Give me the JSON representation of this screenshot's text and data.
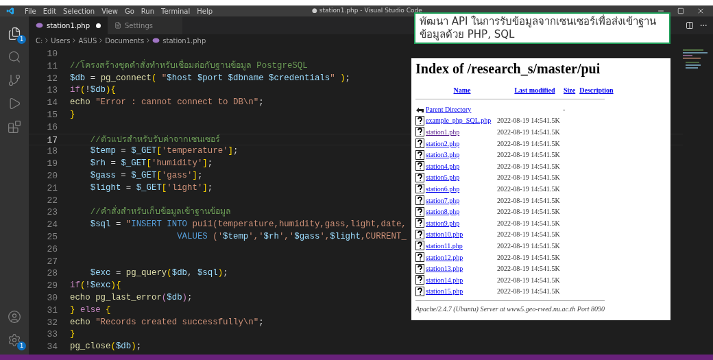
{
  "menu": [
    "File",
    "Edit",
    "Selection",
    "View",
    "Go",
    "Run",
    "Terminal",
    "Help"
  ],
  "window": {
    "title": "● station1.php - Visual Studio Code"
  },
  "activity_bar": {
    "explorer_badge": "1",
    "settings_badge": "1"
  },
  "tabs": [
    {
      "label": "station1.php",
      "selected": true,
      "modified": true,
      "kind": "php"
    },
    {
      "label": "Settings",
      "selected": false,
      "modified": false,
      "kind": "settings"
    }
  ],
  "breadcrumb": [
    "C:",
    "Users",
    "ASUS",
    "Documents",
    "station1.php"
  ],
  "code_lines": [
    {
      "number": "10",
      "active": false
    },
    {
      "number": "11",
      "active": false,
      "tokens": [
        {
          "kind": "comment",
          "t": "//โครงสร้างชุดคำสั่งทำหรับเชื่อมต่อกับฐานข้อมูล PostgreSQL"
        }
      ]
    },
    {
      "number": "12",
      "active": false,
      "tokens": [
        {
          "kind": "var",
          "t": "$db"
        },
        {
          "kind": "punct",
          "t": " = "
        },
        {
          "kind": "fn",
          "t": "pg_connect"
        },
        {
          "kind": "brace",
          "t": "("
        },
        {
          "kind": "str",
          "t": " \""
        },
        {
          "kind": "var",
          "t": "$host $port $dbname $credentials"
        },
        {
          "kind": "str",
          "t": "\" "
        },
        {
          "kind": "brace",
          "t": ")"
        },
        {
          "kind": "punct",
          "t": ";"
        }
      ]
    },
    {
      "number": "13",
      "active": false,
      "tokens": [
        {
          "kind": "kw",
          "t": "if"
        },
        {
          "kind": "brace",
          "t": "("
        },
        {
          "kind": "punct",
          "t": "!"
        },
        {
          "kind": "var",
          "t": "$db"
        },
        {
          "kind": "brace",
          "t": "){"
        }
      ]
    },
    {
      "number": "14",
      "active": false,
      "tokens": [
        {
          "kind": "fn",
          "t": "echo "
        },
        {
          "kind": "str",
          "t": "\"Error : cannot connect to DB\\n\""
        },
        {
          "kind": "punct",
          "t": ";"
        }
      ]
    },
    {
      "number": "15",
      "active": false,
      "tokens": [
        {
          "kind": "brace",
          "t": "}"
        }
      ]
    },
    {
      "number": "16",
      "active": false
    },
    {
      "number": "17",
      "active": true,
      "tokens": [
        {
          "kind": "comment",
          "t": "    //ตัวแปรสำหรับรับค่าจากเซนเซอร์"
        }
      ]
    },
    {
      "number": "18",
      "active": false,
      "tokens": [
        {
          "kind": "var",
          "t": "    $temp"
        },
        {
          "kind": "punct",
          "t": " = "
        },
        {
          "kind": "var",
          "t": "$_GET"
        },
        {
          "kind": "brace",
          "t": "["
        },
        {
          "kind": "str",
          "t": "'temperature'"
        },
        {
          "kind": "brace",
          "t": "]"
        },
        {
          "kind": "punct",
          "t": ";"
        }
      ]
    },
    {
      "number": "19",
      "active": false,
      "tokens": [
        {
          "kind": "var",
          "t": "    $rh"
        },
        {
          "kind": "punct",
          "t": " = "
        },
        {
          "kind": "var",
          "t": "$_GET"
        },
        {
          "kind": "brace",
          "t": "["
        },
        {
          "kind": "str",
          "t": "'humidity'"
        },
        {
          "kind": "brace",
          "t": "]"
        },
        {
          "kind": "punct",
          "t": ";"
        }
      ]
    },
    {
      "number": "20",
      "active": false,
      "tokens": [
        {
          "kind": "var",
          "t": "    $gass"
        },
        {
          "kind": "punct",
          "t": " = "
        },
        {
          "kind": "var",
          "t": "$_GET"
        },
        {
          "kind": "brace",
          "t": "["
        },
        {
          "kind": "str",
          "t": "'gass'"
        },
        {
          "kind": "brace",
          "t": "]"
        },
        {
          "kind": "punct",
          "t": ";"
        }
      ]
    },
    {
      "number": "21",
      "active": false,
      "tokens": [
        {
          "kind": "var",
          "t": "    $light"
        },
        {
          "kind": "punct",
          "t": " = "
        },
        {
          "kind": "var",
          "t": "$_GET"
        },
        {
          "kind": "brace",
          "t": "["
        },
        {
          "kind": "str",
          "t": "'light'"
        },
        {
          "kind": "brace",
          "t": "]"
        },
        {
          "kind": "punct",
          "t": ";"
        }
      ]
    },
    {
      "number": "22",
      "active": false
    },
    {
      "number": "23",
      "active": false,
      "tokens": [
        {
          "kind": "comment",
          "t": "    //คำสั่งสำหรับเก็บข้อมูลเข้าฐานข้อมูล"
        }
      ]
    },
    {
      "number": "24",
      "active": false,
      "tokens": [
        {
          "kind": "var",
          "t": "    $sql"
        },
        {
          "kind": "punct",
          "t": " = "
        },
        {
          "kind": "str",
          "t": "\""
        },
        {
          "kind": "sql",
          "t": "INSERT INTO "
        },
        {
          "kind": "str",
          "t": "pui1(temperature,humidity,gass,light,date,"
        }
      ]
    },
    {
      "number": "25",
      "active": false,
      "tokens": [
        {
          "kind": "sql",
          "t": "                     VALUES "
        },
        {
          "kind": "str",
          "t": "('"
        },
        {
          "kind": "var",
          "t": "$temp"
        },
        {
          "kind": "str",
          "t": "','"
        },
        {
          "kind": "var",
          "t": "$rh"
        },
        {
          "kind": "str",
          "t": "','"
        },
        {
          "kind": "var",
          "t": "$gass"
        },
        {
          "kind": "str",
          "t": "',"
        },
        {
          "kind": "var",
          "t": "$light"
        },
        {
          "kind": "str",
          "t": ",CURRENT_"
        }
      ]
    },
    {
      "number": "26",
      "active": false
    },
    {
      "number": "27",
      "active": false
    },
    {
      "number": "28",
      "active": false,
      "tokens": [
        {
          "kind": "var",
          "t": "    $exc"
        },
        {
          "kind": "punct",
          "t": " = "
        },
        {
          "kind": "fn",
          "t": "pg_query"
        },
        {
          "kind": "brace",
          "t": "("
        },
        {
          "kind": "var",
          "t": "$db"
        },
        {
          "kind": "punct",
          "t": ", "
        },
        {
          "kind": "var",
          "t": "$sql"
        },
        {
          "kind": "brace",
          "t": ")"
        },
        {
          "kind": "punct",
          "t": ";"
        }
      ]
    },
    {
      "number": "29",
      "active": false,
      "tokens": [
        {
          "kind": "kw",
          "t": "if"
        },
        {
          "kind": "brace",
          "t": "("
        },
        {
          "kind": "punct",
          "t": "!"
        },
        {
          "kind": "var",
          "t": "$exc"
        },
        {
          "kind": "brace",
          "t": "){"
        }
      ]
    },
    {
      "number": "30",
      "active": false,
      "tokens": [
        {
          "kind": "fn",
          "t": "echo pg_last_error"
        },
        {
          "kind": "kw",
          "t": "("
        },
        {
          "kind": "var",
          "t": "$db"
        },
        {
          "kind": "kw",
          "t": ")"
        },
        {
          "kind": "punct",
          "t": ";"
        }
      ]
    },
    {
      "number": "31",
      "active": false,
      "tokens": [
        {
          "kind": "brace",
          "t": "} "
        },
        {
          "kind": "kw",
          "t": "else "
        },
        {
          "kind": "brace",
          "t": "{"
        }
      ]
    },
    {
      "number": "32",
      "active": false,
      "tokens": [
        {
          "kind": "fn",
          "t": "echo "
        },
        {
          "kind": "str",
          "t": "\"Records created successfully\\n\""
        },
        {
          "kind": "punct",
          "t": ";"
        }
      ]
    },
    {
      "number": "33",
      "active": false,
      "tokens": [
        {
          "kind": "brace",
          "t": "}"
        }
      ]
    },
    {
      "number": "34",
      "active": false,
      "tokens": [
        {
          "kind": "fn",
          "t": "pg_close"
        },
        {
          "kind": "brace",
          "t": "("
        },
        {
          "kind": "var",
          "t": "$db"
        },
        {
          "kind": "brace",
          "t": ")"
        },
        {
          "kind": "punct",
          "t": ";"
        }
      ]
    }
  ],
  "caption": "พัฒนา API ในการรับข้อมูลจากเซนเซอร์เพื่อส่งเข้าฐานข้อมูลด้วย PHP, SQL",
  "index_page": {
    "title": "Index of /research_s/master/pui",
    "columns": [
      "Name",
      "Last modified",
      "Size",
      "Description"
    ],
    "rows": [
      {
        "kind": "parent",
        "name": "Parent Directory",
        "modified": "",
        "size": "-",
        "visited": false
      },
      {
        "kind": "file",
        "name": "example_php_SQL.php",
        "modified": "2022-08-19 14:54",
        "size": "1.5K",
        "visited": false
      },
      {
        "kind": "file",
        "name": "station1.php",
        "modified": "2022-08-19 14:54",
        "size": "1.5K",
        "visited": true
      },
      {
        "kind": "file",
        "name": "station2.php",
        "modified": "2022-08-19 14:54",
        "size": "1.5K",
        "visited": false
      },
      {
        "kind": "file",
        "name": "station3.php",
        "modified": "2022-08-19 14:54",
        "size": "1.5K",
        "visited": false
      },
      {
        "kind": "file",
        "name": "station4.php",
        "modified": "2022-08-19 14:54",
        "size": "1.5K",
        "visited": false
      },
      {
        "kind": "file",
        "name": "station5.php",
        "modified": "2022-08-19 14:54",
        "size": "1.5K",
        "visited": false
      },
      {
        "kind": "file",
        "name": "station6.php",
        "modified": "2022-08-19 14:54",
        "size": "1.5K",
        "visited": false
      },
      {
        "kind": "file",
        "name": "station7.php",
        "modified": "2022-08-19 14:54",
        "size": "1.5K",
        "visited": false
      },
      {
        "kind": "file",
        "name": "station8.php",
        "modified": "2022-08-19 14:54",
        "size": "1.5K",
        "visited": false
      },
      {
        "kind": "file",
        "name": "station9.php",
        "modified": "2022-08-19 14:54",
        "size": "1.5K",
        "visited": false
      },
      {
        "kind": "file",
        "name": "station10.php",
        "modified": "2022-08-19 14:54",
        "size": "1.5K",
        "visited": false
      },
      {
        "kind": "file",
        "name": "station11.php",
        "modified": "2022-08-19 14:54",
        "size": "1.5K",
        "visited": false
      },
      {
        "kind": "file",
        "name": "station12.php",
        "modified": "2022-08-19 14:54",
        "size": "1.5K",
        "visited": false
      },
      {
        "kind": "file",
        "name": "station13.php",
        "modified": "2022-08-19 14:54",
        "size": "1.5K",
        "visited": false
      },
      {
        "kind": "file",
        "name": "station14.php",
        "modified": "2022-08-19 14:54",
        "size": "1.5K",
        "visited": false
      },
      {
        "kind": "file",
        "name": "station15.php",
        "modified": "2022-08-19 14:54",
        "size": "1.5K",
        "visited": false
      }
    ],
    "footer": "Apache/2.4.7 (Ubuntu) Server at www5.geo-rwed.nu.ac.th Port 8090"
  }
}
